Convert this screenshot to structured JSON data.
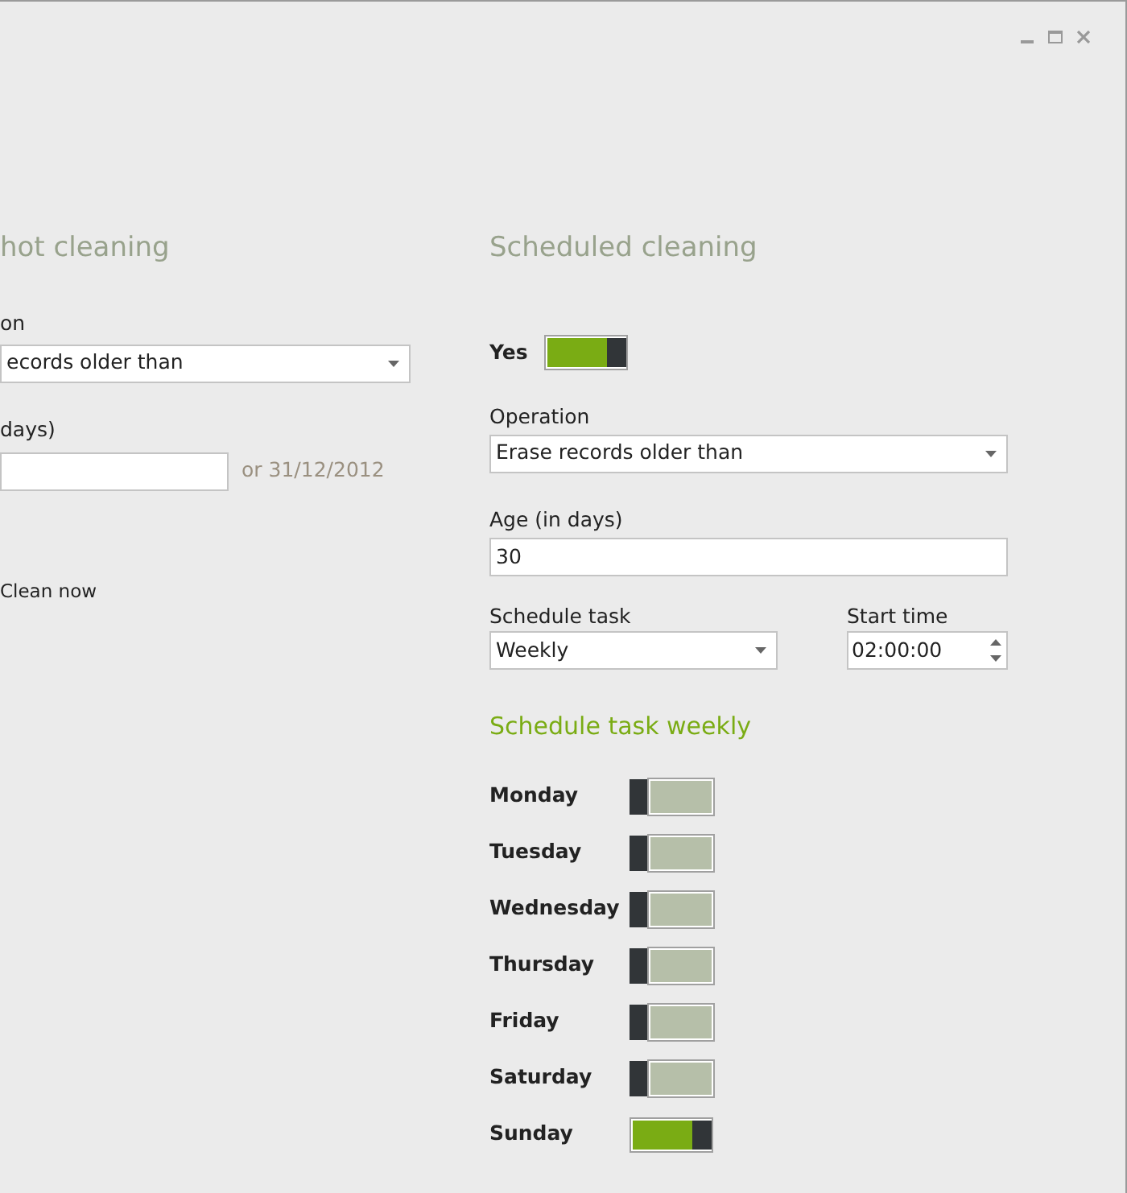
{
  "window": {
    "controls": [
      {
        "kind": "minimize"
      },
      {
        "kind": "maximize"
      },
      {
        "kind": "close"
      }
    ]
  },
  "one_shot": {
    "title": "hot cleaning",
    "operation_label": "on",
    "operation_value": "ecords older than",
    "age_label": "days)",
    "date_hint": "or 31/12/2012",
    "clean_now": "Clean now"
  },
  "scheduled": {
    "title": "Scheduled cleaning",
    "enabled_label": "Yes",
    "enabled": true,
    "operation_label": "Operation",
    "operation_value": "Erase records older than",
    "age_label": "Age (in days)",
    "age_value": "30",
    "schedule_label": "Schedule task",
    "schedule_value": "Weekly",
    "start_label": "Start time",
    "start_value": "02:00:00",
    "weekly_title": "Schedule task weekly",
    "days": [
      {
        "label": "Monday",
        "on": false
      },
      {
        "label": "Tuesday",
        "on": false
      },
      {
        "label": "Wednesday",
        "on": false
      },
      {
        "label": "Thursday",
        "on": false
      },
      {
        "label": "Friday",
        "on": false
      },
      {
        "label": "Saturday",
        "on": false
      },
      {
        "label": "Sunday",
        "on": true
      }
    ]
  }
}
